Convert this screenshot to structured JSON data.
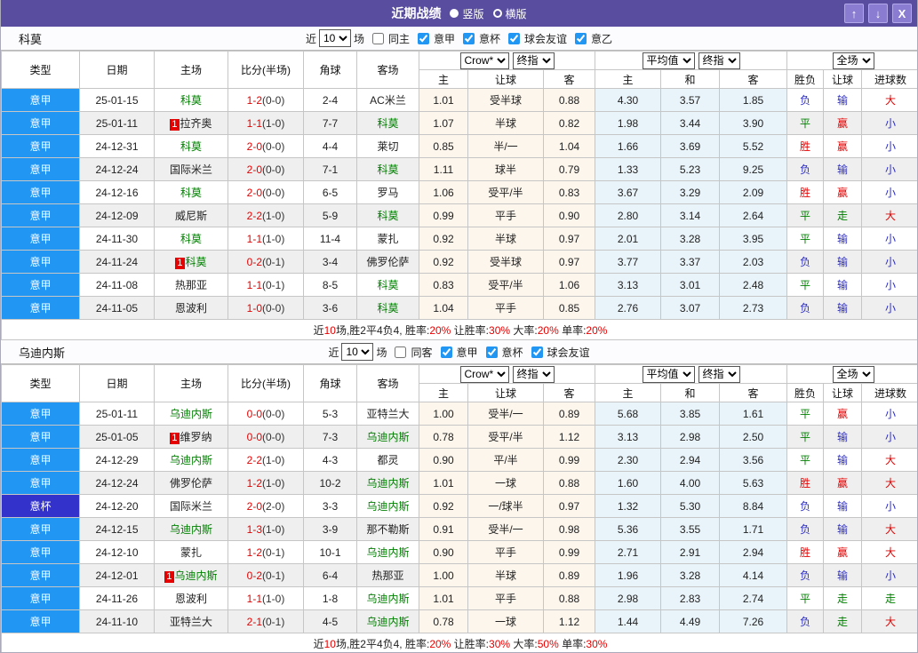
{
  "title_bar": {
    "title": "近期战绩",
    "radio_vertical": "竖版",
    "radio_horizontal": "横版",
    "up_icon": "↑",
    "down_icon": "↓",
    "close_icon": "X"
  },
  "colors": {
    "title_purple": "#584d9e",
    "button_purple": "#8a7cd0",
    "league_blue": "#2196f3",
    "cup_blue": "#3333cc",
    "team_green": "#008000",
    "score_red": "#e60000",
    "result_red": "#e60000",
    "result_green": "#008000",
    "result_blue": "#2d2dc8",
    "odds_cream_bg": "#fdf6ec",
    "odds_blue_bg": "#e9f4fa"
  },
  "table_headers": {
    "main": [
      "类型",
      "日期",
      "主场",
      "比分(半场)",
      "角球",
      "客场"
    ],
    "sub": [
      "主",
      "让球",
      "客",
      "主",
      "和",
      "客",
      "胜负",
      "让球",
      "进球数"
    ],
    "group1_dropdowns": [
      "Crow*",
      "终指"
    ],
    "group2_dropdowns": [
      "平均值",
      "终指"
    ],
    "group3_dropdowns": [
      "全场"
    ]
  },
  "sections": [
    {
      "team": "科莫",
      "filter": {
        "near_label": "近",
        "count": "10",
        "games_label": "场",
        "same_label": "同主",
        "same_checked": false,
        "leagues": [
          {
            "label": "意甲",
            "checked": true
          },
          {
            "label": "意杯",
            "checked": true
          },
          {
            "label": "球会友谊",
            "checked": true
          },
          {
            "label": "意乙",
            "checked": true
          }
        ]
      },
      "rows": [
        {
          "type": "意甲",
          "kind": "league",
          "date": "25-01-15",
          "home": {
            "name": "科莫",
            "green": true
          },
          "score": "1-2",
          "half": "(0-0)",
          "corner": "2-4",
          "away": {
            "name": "AC米兰",
            "green": false
          },
          "odds1": [
            "1.01",
            "受半球",
            "0.88"
          ],
          "avg": [
            "4.30",
            "3.57",
            "1.85"
          ],
          "results": [
            {
              "t": "负",
              "c": "b"
            },
            {
              "t": "输",
              "c": "b"
            },
            {
              "t": "大",
              "c": "r"
            }
          ]
        },
        {
          "type": "意甲",
          "kind": "league",
          "date": "25-01-11",
          "home": {
            "name": "拉齐奥",
            "green": false,
            "badge": "1"
          },
          "score": "1-1",
          "half": "(1-0)",
          "corner": "7-7",
          "away": {
            "name": "科莫",
            "green": true
          },
          "odds1": [
            "1.07",
            "半球",
            "0.82"
          ],
          "avg": [
            "1.98",
            "3.44",
            "3.90"
          ],
          "results": [
            {
              "t": "平",
              "c": "g"
            },
            {
              "t": "赢",
              "c": "r"
            },
            {
              "t": "小",
              "c": "b"
            }
          ]
        },
        {
          "type": "意甲",
          "kind": "league",
          "date": "24-12-31",
          "home": {
            "name": "科莫",
            "green": true
          },
          "score": "2-0",
          "half": "(0-0)",
          "corner": "4-4",
          "away": {
            "name": "莱切",
            "green": false
          },
          "odds1": [
            "0.85",
            "半/一",
            "1.04"
          ],
          "avg": [
            "1.66",
            "3.69",
            "5.52"
          ],
          "results": [
            {
              "t": "胜",
              "c": "r"
            },
            {
              "t": "赢",
              "c": "r"
            },
            {
              "t": "小",
              "c": "b"
            }
          ]
        },
        {
          "type": "意甲",
          "kind": "league",
          "date": "24-12-24",
          "home": {
            "name": "国际米兰",
            "green": false
          },
          "score": "2-0",
          "half": "(0-0)",
          "corner": "7-1",
          "away": {
            "name": "科莫",
            "green": true
          },
          "odds1": [
            "1.11",
            "球半",
            "0.79"
          ],
          "avg": [
            "1.33",
            "5.23",
            "9.25"
          ],
          "results": [
            {
              "t": "负",
              "c": "b"
            },
            {
              "t": "输",
              "c": "b"
            },
            {
              "t": "小",
              "c": "b"
            }
          ]
        },
        {
          "type": "意甲",
          "kind": "league",
          "date": "24-12-16",
          "home": {
            "name": "科莫",
            "green": true
          },
          "score": "2-0",
          "half": "(0-0)",
          "corner": "6-5",
          "away": {
            "name": "罗马",
            "green": false
          },
          "odds1": [
            "1.06",
            "受平/半",
            "0.83"
          ],
          "avg": [
            "3.67",
            "3.29",
            "2.09"
          ],
          "results": [
            {
              "t": "胜",
              "c": "r"
            },
            {
              "t": "赢",
              "c": "r"
            },
            {
              "t": "小",
              "c": "b"
            }
          ]
        },
        {
          "type": "意甲",
          "kind": "league",
          "date": "24-12-09",
          "home": {
            "name": "威尼斯",
            "green": false
          },
          "score": "2-2",
          "half": "(1-0)",
          "corner": "5-9",
          "away": {
            "name": "科莫",
            "green": true
          },
          "odds1": [
            "0.99",
            "平手",
            "0.90"
          ],
          "avg": [
            "2.80",
            "3.14",
            "2.64"
          ],
          "results": [
            {
              "t": "平",
              "c": "g"
            },
            {
              "t": "走",
              "c": "g"
            },
            {
              "t": "大",
              "c": "r"
            }
          ]
        },
        {
          "type": "意甲",
          "kind": "league",
          "date": "24-11-30",
          "home": {
            "name": "科莫",
            "green": true
          },
          "score": "1-1",
          "half": "(1-0)",
          "corner": "11-4",
          "away": {
            "name": "蒙扎",
            "green": false
          },
          "odds1": [
            "0.92",
            "半球",
            "0.97"
          ],
          "avg": [
            "2.01",
            "3.28",
            "3.95"
          ],
          "results": [
            {
              "t": "平",
              "c": "g"
            },
            {
              "t": "输",
              "c": "b"
            },
            {
              "t": "小",
              "c": "b"
            }
          ]
        },
        {
          "type": "意甲",
          "kind": "league",
          "date": "24-11-24",
          "home": {
            "name": "科莫",
            "green": true,
            "badge": "1"
          },
          "score": "0-2",
          "half": "(0-1)",
          "corner": "3-4",
          "away": {
            "name": "佛罗伦萨",
            "green": false
          },
          "odds1": [
            "0.92",
            "受半球",
            "0.97"
          ],
          "avg": [
            "3.77",
            "3.37",
            "2.03"
          ],
          "results": [
            {
              "t": "负",
              "c": "b"
            },
            {
              "t": "输",
              "c": "b"
            },
            {
              "t": "小",
              "c": "b"
            }
          ]
        },
        {
          "type": "意甲",
          "kind": "league",
          "date": "24-11-08",
          "home": {
            "name": "热那亚",
            "green": false
          },
          "score": "1-1",
          "half": "(0-1)",
          "corner": "8-5",
          "away": {
            "name": "科莫",
            "green": true
          },
          "odds1": [
            "0.83",
            "受平/半",
            "1.06"
          ],
          "avg": [
            "3.13",
            "3.01",
            "2.48"
          ],
          "results": [
            {
              "t": "平",
              "c": "g"
            },
            {
              "t": "输",
              "c": "b"
            },
            {
              "t": "小",
              "c": "b"
            }
          ]
        },
        {
          "type": "意甲",
          "kind": "league",
          "date": "24-11-05",
          "home": {
            "name": "恩波利",
            "green": false
          },
          "score": "1-0",
          "half": "(0-0)",
          "corner": "3-6",
          "away": {
            "name": "科莫",
            "green": true
          },
          "odds1": [
            "1.04",
            "平手",
            "0.85"
          ],
          "avg": [
            "2.76",
            "3.07",
            "2.73"
          ],
          "results": [
            {
              "t": "负",
              "c": "b"
            },
            {
              "t": "输",
              "c": "b"
            },
            {
              "t": "小",
              "c": "b"
            }
          ]
        }
      ],
      "summary": [
        {
          "text": "近",
          "red": false
        },
        {
          "text": "10",
          "red": true
        },
        {
          "text": "场,胜2平4负4, 胜率:",
          "red": false
        },
        {
          "text": "20%",
          "red": true
        },
        {
          "text": " 让胜率:",
          "red": false
        },
        {
          "text": "30%",
          "red": true
        },
        {
          "text": " 大率:",
          "red": false
        },
        {
          "text": "20%",
          "red": true
        },
        {
          "text": " 单率:",
          "red": false
        },
        {
          "text": "20%",
          "red": true
        }
      ]
    },
    {
      "team": "乌迪内斯",
      "filter": {
        "near_label": "近",
        "count": "10",
        "games_label": "场",
        "same_label": "同客",
        "same_checked": false,
        "leagues": [
          {
            "label": "意甲",
            "checked": true
          },
          {
            "label": "意杯",
            "checked": true
          },
          {
            "label": "球会友谊",
            "checked": true
          }
        ]
      },
      "rows": [
        {
          "type": "意甲",
          "kind": "league",
          "date": "25-01-11",
          "home": {
            "name": "乌迪内斯",
            "green": true
          },
          "score": "0-0",
          "half": "(0-0)",
          "corner": "5-3",
          "away": {
            "name": "亚特兰大",
            "green": false
          },
          "odds1": [
            "1.00",
            "受半/一",
            "0.89"
          ],
          "avg": [
            "5.68",
            "3.85",
            "1.61"
          ],
          "results": [
            {
              "t": "平",
              "c": "g"
            },
            {
              "t": "赢",
              "c": "r"
            },
            {
              "t": "小",
              "c": "b"
            }
          ]
        },
        {
          "type": "意甲",
          "kind": "league",
          "date": "25-01-05",
          "home": {
            "name": "维罗纳",
            "green": false,
            "badge": "1"
          },
          "score": "0-0",
          "half": "(0-0)",
          "corner": "7-3",
          "away": {
            "name": "乌迪内斯",
            "green": true
          },
          "odds1": [
            "0.78",
            "受平/半",
            "1.12"
          ],
          "avg": [
            "3.13",
            "2.98",
            "2.50"
          ],
          "results": [
            {
              "t": "平",
              "c": "g"
            },
            {
              "t": "输",
              "c": "b"
            },
            {
              "t": "小",
              "c": "b"
            }
          ]
        },
        {
          "type": "意甲",
          "kind": "league",
          "date": "24-12-29",
          "home": {
            "name": "乌迪内斯",
            "green": true
          },
          "score": "2-2",
          "half": "(1-0)",
          "corner": "4-3",
          "away": {
            "name": "都灵",
            "green": false
          },
          "odds1": [
            "0.90",
            "平/半",
            "0.99"
          ],
          "avg": [
            "2.30",
            "2.94",
            "3.56"
          ],
          "results": [
            {
              "t": "平",
              "c": "g"
            },
            {
              "t": "输",
              "c": "b"
            },
            {
              "t": "大",
              "c": "r"
            }
          ]
        },
        {
          "type": "意甲",
          "kind": "league",
          "date": "24-12-24",
          "home": {
            "name": "佛罗伦萨",
            "green": false
          },
          "score": "1-2",
          "half": "(1-0)",
          "corner": "10-2",
          "away": {
            "name": "乌迪内斯",
            "green": true
          },
          "odds1": [
            "1.01",
            "一球",
            "0.88"
          ],
          "avg": [
            "1.60",
            "4.00",
            "5.63"
          ],
          "results": [
            {
              "t": "胜",
              "c": "r"
            },
            {
              "t": "赢",
              "c": "r"
            },
            {
              "t": "大",
              "c": "r"
            }
          ]
        },
        {
          "type": "意杯",
          "kind": "cup",
          "date": "24-12-20",
          "home": {
            "name": "国际米兰",
            "green": false
          },
          "score": "2-0",
          "half": "(2-0)",
          "corner": "3-3",
          "away": {
            "name": "乌迪内斯",
            "green": true
          },
          "odds1": [
            "0.92",
            "一/球半",
            "0.97"
          ],
          "avg": [
            "1.32",
            "5.30",
            "8.84"
          ],
          "results": [
            {
              "t": "负",
              "c": "b"
            },
            {
              "t": "输",
              "c": "b"
            },
            {
              "t": "小",
              "c": "b"
            }
          ]
        },
        {
          "type": "意甲",
          "kind": "league",
          "date": "24-12-15",
          "home": {
            "name": "乌迪内斯",
            "green": true
          },
          "score": "1-3",
          "half": "(1-0)",
          "corner": "3-9",
          "away": {
            "name": "那不勒斯",
            "green": false
          },
          "odds1": [
            "0.91",
            "受半/一",
            "0.98"
          ],
          "avg": [
            "5.36",
            "3.55",
            "1.71"
          ],
          "results": [
            {
              "t": "负",
              "c": "b"
            },
            {
              "t": "输",
              "c": "b"
            },
            {
              "t": "大",
              "c": "r"
            }
          ]
        },
        {
          "type": "意甲",
          "kind": "league",
          "date": "24-12-10",
          "home": {
            "name": "蒙扎",
            "green": false
          },
          "score": "1-2",
          "half": "(0-1)",
          "corner": "10-1",
          "away": {
            "name": "乌迪内斯",
            "green": true
          },
          "odds1": [
            "0.90",
            "平手",
            "0.99"
          ],
          "avg": [
            "2.71",
            "2.91",
            "2.94"
          ],
          "results": [
            {
              "t": "胜",
              "c": "r"
            },
            {
              "t": "赢",
              "c": "r"
            },
            {
              "t": "大",
              "c": "r"
            }
          ]
        },
        {
          "type": "意甲",
          "kind": "league",
          "date": "24-12-01",
          "home": {
            "name": "乌迪内斯",
            "green": true,
            "badge": "1"
          },
          "score": "0-2",
          "half": "(0-1)",
          "corner": "6-4",
          "away": {
            "name": "热那亚",
            "green": false
          },
          "odds1": [
            "1.00",
            "半球",
            "0.89"
          ],
          "avg": [
            "1.96",
            "3.28",
            "4.14"
          ],
          "results": [
            {
              "t": "负",
              "c": "b"
            },
            {
              "t": "输",
              "c": "b"
            },
            {
              "t": "小",
              "c": "b"
            }
          ]
        },
        {
          "type": "意甲",
          "kind": "league",
          "date": "24-11-26",
          "home": {
            "name": "恩波利",
            "green": false
          },
          "score": "1-1",
          "half": "(1-0)",
          "corner": "1-8",
          "away": {
            "name": "乌迪内斯",
            "green": true
          },
          "odds1": [
            "1.01",
            "平手",
            "0.88"
          ],
          "avg": [
            "2.98",
            "2.83",
            "2.74"
          ],
          "results": [
            {
              "t": "平",
              "c": "g"
            },
            {
              "t": "走",
              "c": "g"
            },
            {
              "t": "走",
              "c": "g"
            }
          ]
        },
        {
          "type": "意甲",
          "kind": "league",
          "date": "24-11-10",
          "home": {
            "name": "亚特兰大",
            "green": false
          },
          "score": "2-1",
          "half": "(0-1)",
          "corner": "4-5",
          "away": {
            "name": "乌迪内斯",
            "green": true
          },
          "odds1": [
            "0.78",
            "一球",
            "1.12"
          ],
          "avg": [
            "1.44",
            "4.49",
            "7.26"
          ],
          "results": [
            {
              "t": "负",
              "c": "b"
            },
            {
              "t": "走",
              "c": "g"
            },
            {
              "t": "大",
              "c": "r"
            }
          ]
        }
      ],
      "summary": [
        {
          "text": "近",
          "red": false
        },
        {
          "text": "10",
          "red": true
        },
        {
          "text": "场,胜2平4负4, 胜率:",
          "red": false
        },
        {
          "text": "20%",
          "red": true
        },
        {
          "text": " 让胜率:",
          "red": false
        },
        {
          "text": "30%",
          "red": true
        },
        {
          "text": " 大率:",
          "red": false
        },
        {
          "text": "50%",
          "red": true
        },
        {
          "text": " 单率:",
          "red": false
        },
        {
          "text": "30%",
          "red": true
        }
      ]
    }
  ]
}
